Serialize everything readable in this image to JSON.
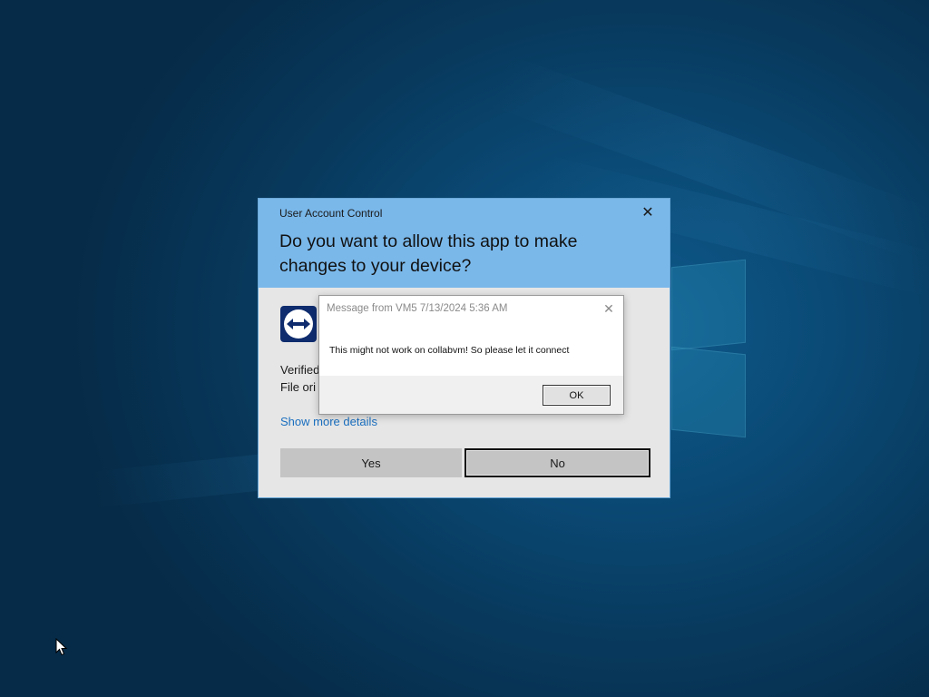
{
  "uac": {
    "caption": "User Account Control",
    "close_glyph": "✕",
    "question": "Do you want to allow this app to make changes to your device?",
    "app_icon": "teamviewer-icon",
    "verified_label": "Verified",
    "origin_label": "File ori",
    "details_link": "Show more details",
    "yes_label": "Yes",
    "no_label": "No",
    "header_color": "#7ab8ea",
    "body_color": "#e6e6e6"
  },
  "message_box": {
    "title": "Message from VM5 7/13/2024 5:36 AM",
    "close_glyph": "✕",
    "text": "This might not work on collabvm! So please let it connect",
    "ok_label": "OK"
  },
  "desktop": {
    "background_color": "#0a4a76",
    "logo_icon": "windows-logo-icon",
    "cursor_icon": "mouse-pointer-icon"
  }
}
